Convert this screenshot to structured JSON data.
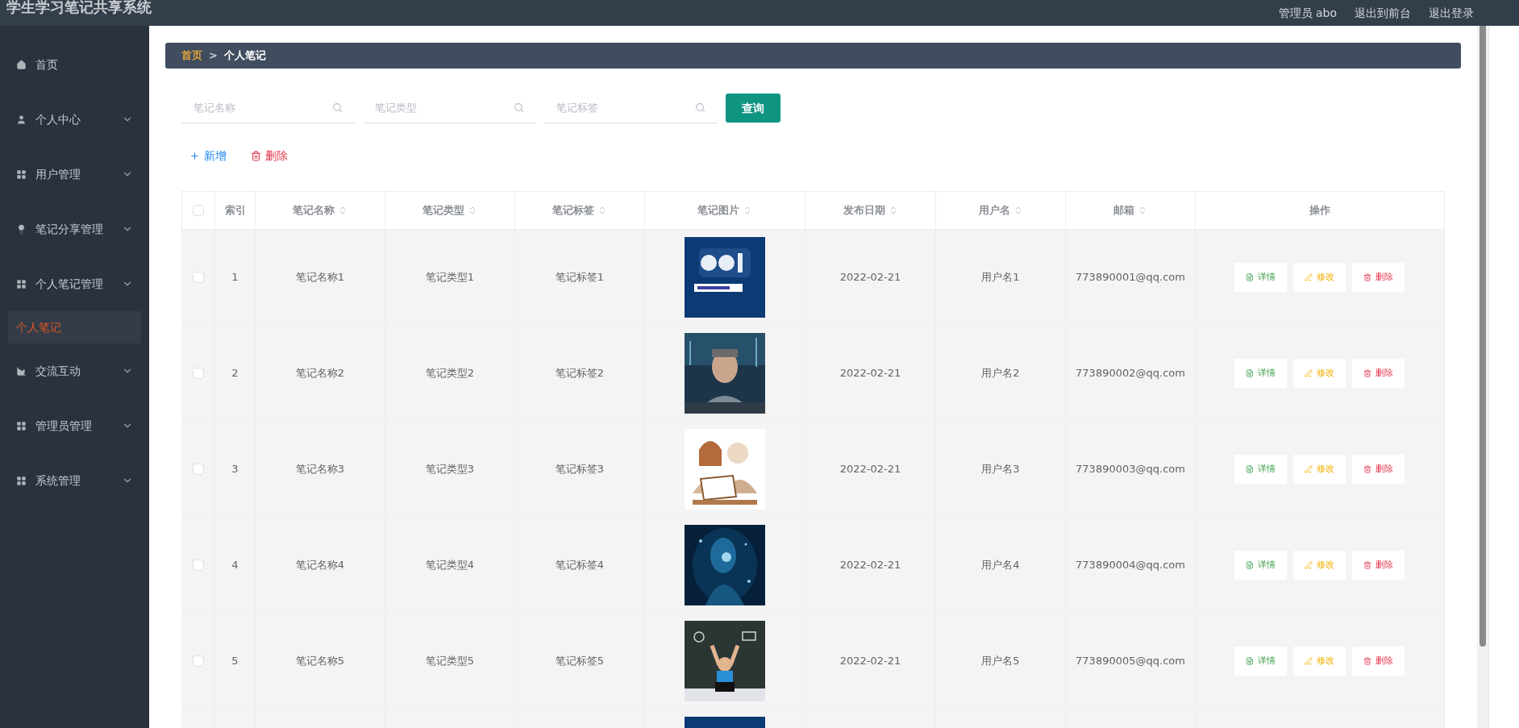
{
  "header": {
    "title": "学生学习笔记共享系统",
    "user_label": "管理员 abo",
    "links": [
      "退出到前台",
      "退出登录"
    ]
  },
  "sidebar": {
    "items": [
      {
        "label": "首页",
        "has_submenu": false
      },
      {
        "label": "个人中心",
        "has_submenu": true
      },
      {
        "label": "用户管理",
        "has_submenu": true
      },
      {
        "label": "笔记分享管理",
        "has_submenu": true
      },
      {
        "label": "个人笔记管理",
        "has_submenu": true,
        "children": [
          {
            "label": "个人笔记",
            "selected": true
          }
        ]
      },
      {
        "label": "交流互动",
        "has_submenu": true
      },
      {
        "label": "管理员管理",
        "has_submenu": true
      },
      {
        "label": "系统管理",
        "has_submenu": true
      }
    ]
  },
  "breadcrumb": {
    "items": [
      "首页",
      "个人笔记"
    ],
    "separator": ">"
  },
  "search": {
    "fields": [
      {
        "placeholder": "笔记名称"
      },
      {
        "placeholder": "笔记类型"
      },
      {
        "placeholder": "笔记标签"
      }
    ],
    "button": "查询"
  },
  "toolbar": [
    {
      "label": "新增",
      "kind": "add"
    },
    {
      "label": "删除",
      "kind": "delete"
    }
  ],
  "table": {
    "select_all": {
      "checked": false
    },
    "columns": [
      {
        "label": "索引",
        "sortable": false
      },
      {
        "label": "笔记名称",
        "sortable": true
      },
      {
        "label": "笔记类型",
        "sortable": true
      },
      {
        "label": "笔记标签",
        "sortable": true
      },
      {
        "label": "笔记图片",
        "sortable": true
      },
      {
        "label": "发布日期",
        "sortable": true
      },
      {
        "label": "用户名",
        "sortable": true
      },
      {
        "label": "邮箱",
        "sortable": true
      },
      {
        "label": "操作",
        "sortable": false
      }
    ],
    "rows": [
      {
        "checked": false,
        "index": "1",
        "name": "笔记名称1",
        "type": "笔记类型1",
        "tag": "笔记标签1",
        "image": {
          "kind": "picture"
        },
        "date": "2022-02-21",
        "user": "用户名1",
        "email": "773890001@qq.com",
        "actions": [
          {
            "label": "详情",
            "kind": "detail"
          },
          {
            "label": "修改",
            "kind": "edit"
          },
          {
            "label": "删除",
            "kind": "delete"
          }
        ]
      },
      {
        "checked": false,
        "index": "2",
        "name": "笔记名称2",
        "type": "笔记类型2",
        "tag": "笔记标签2",
        "image": {
          "kind": "picture"
        },
        "date": "2022-02-21",
        "user": "用户名2",
        "email": "773890002@qq.com",
        "actions": [
          {
            "label": "详情",
            "kind": "detail"
          },
          {
            "label": "修改",
            "kind": "edit"
          },
          {
            "label": "删除",
            "kind": "delete"
          }
        ]
      },
      {
        "checked": false,
        "index": "3",
        "name": "笔记名称3",
        "type": "笔记类型3",
        "tag": "笔记标签3",
        "image": {
          "kind": "picture"
        },
        "date": "2022-02-21",
        "user": "用户名3",
        "email": "773890003@qq.com",
        "actions": [
          {
            "label": "详情",
            "kind": "detail"
          },
          {
            "label": "修改",
            "kind": "edit"
          },
          {
            "label": "删除",
            "kind": "delete"
          }
        ]
      },
      {
        "checked": false,
        "index": "4",
        "name": "笔记名称4",
        "type": "笔记类型4",
        "tag": "笔记标签4",
        "image": {
          "kind": "picture"
        },
        "date": "2022-02-21",
        "user": "用户名4",
        "email": "773890004@qq.com",
        "actions": [
          {
            "label": "详情",
            "kind": "detail"
          },
          {
            "label": "修改",
            "kind": "edit"
          },
          {
            "label": "删除",
            "kind": "delete"
          }
        ]
      },
      {
        "checked": false,
        "index": "5",
        "name": "笔记名称5",
        "type": "笔记类型5",
        "tag": "笔记标签5",
        "image": {
          "kind": "picture"
        },
        "date": "2022-02-21",
        "user": "用户名5",
        "email": "773890005@qq.com",
        "actions": [
          {
            "label": "详情",
            "kind": "detail"
          },
          {
            "label": "修改",
            "kind": "edit"
          },
          {
            "label": "删除",
            "kind": "delete"
          }
        ]
      },
      {
        "image": {
          "kind": "picture"
        }
      }
    ]
  }
}
